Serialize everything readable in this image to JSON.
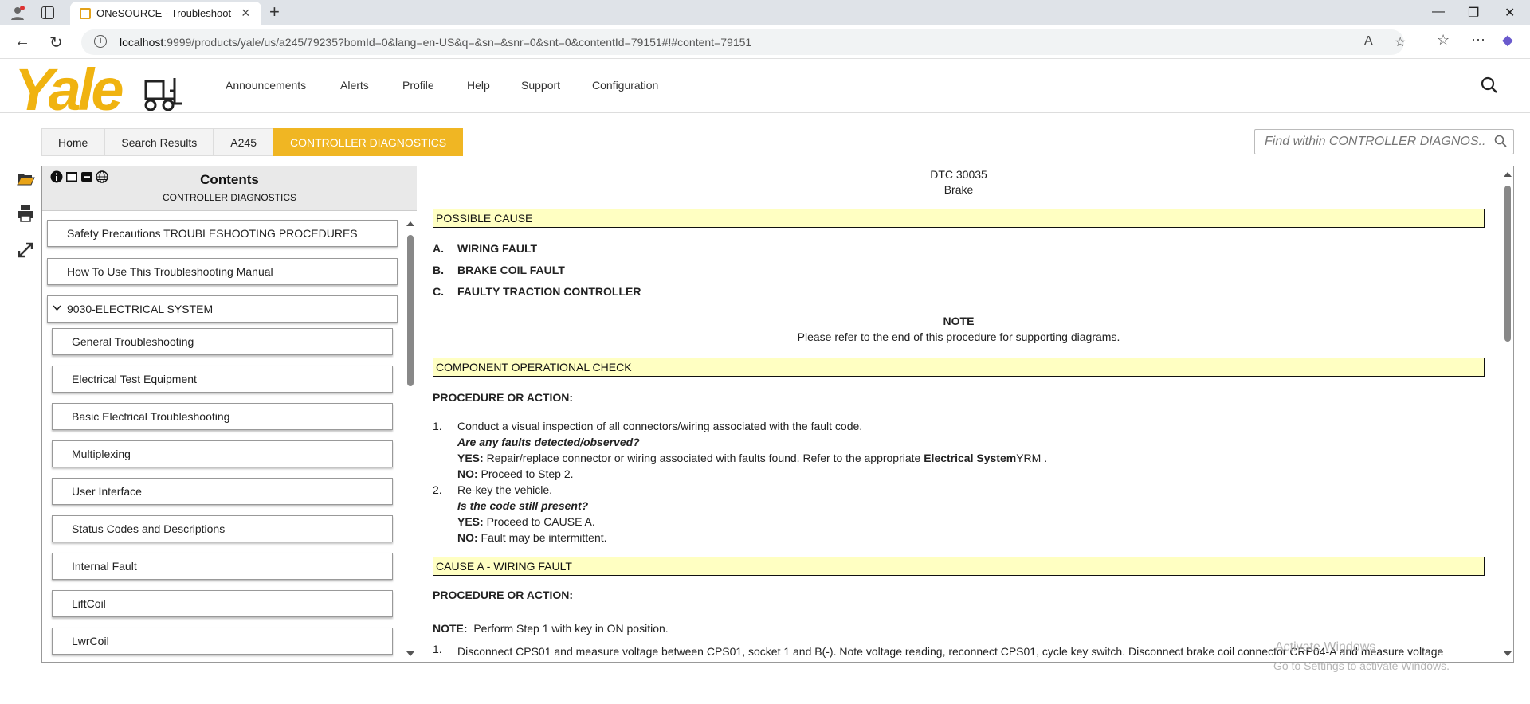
{
  "browser": {
    "tab_title": "ONeSOURCE - Troubleshooting -",
    "url_host": "localhost",
    "url_rest": ":9999/products/yale/us/a245/79235?bomId=0&lang=en-US&q=&sn=&snr=0&snt=0&contentId=79151#!#content=79151"
  },
  "header": {
    "logo": "Yale",
    "nav": [
      "Announcements",
      "Alerts",
      "Profile",
      "Help",
      "Support",
      "Configuration"
    ]
  },
  "breadcrumb": [
    "Home",
    "Search Results",
    "A245",
    "CONTROLLER DIAGNOSTICS"
  ],
  "find": {
    "placeholder": "Find within CONTROLLER DIAGNOS..."
  },
  "contents": {
    "title": "Contents",
    "subtitle": "CONTROLLER DIAGNOSTICS",
    "items": [
      "Safety Precautions TROUBLESHOOTING PROCEDURES",
      "How To Use This Troubleshooting Manual",
      "9030-ELECTRICAL SYSTEM",
      "General Troubleshooting",
      "Electrical Test Equipment",
      "Basic Electrical Troubleshooting",
      "Multiplexing",
      "User Interface",
      "Status Codes and Descriptions",
      "Internal Fault",
      "LiftCoil",
      "LwrCoil"
    ]
  },
  "doc": {
    "dtc": "DTC 30035",
    "name": "Brake",
    "possible_cause": "POSSIBLE CAUSE",
    "causes": [
      {
        "letter": "A.",
        "text": "WIRING FAULT"
      },
      {
        "letter": "B.",
        "text": "BRAKE COIL FAULT"
      },
      {
        "letter": "C.",
        "text": "FAULTY TRACTION CONTROLLER"
      }
    ],
    "note_title": "NOTE",
    "note_text": "Please refer to the end of this procedure for supporting diagrams.",
    "component_check": "COMPONENT OPERATIONAL CHECK",
    "proc_label": "PROCEDURE OR ACTION:",
    "step1_num": "1.",
    "step1_text": "Conduct a visual inspection of all connectors/wiring associated with the fault code.",
    "step1_q": "Are any faults detected/observed?",
    "yes": "YES:",
    "no": "NO:",
    "step1_yes": " Repair/replace connector or wiring associated with faults found. Refer to the appropriate ",
    "step1_yes_bold": "Electrical System",
    "step1_yes_end": "YRM .",
    "step1_no": " Proceed to ",
    "step1_no_link": "Step 2",
    "step1_no_end": ".",
    "step2_num": "2.",
    "step2_text": "Re-key the vehicle.",
    "step2_q": "Is the code still present?",
    "step2_yes": " Proceed to ",
    "step2_yes_link": "CAUSE A",
    "step2_yes_end": ".",
    "step2_no": " Fault may be intermittent.",
    "cause_a": "CAUSE A - WIRING FAULT",
    "proc_label2": "PROCEDURE OR ACTION:",
    "note2_label": "NOTE:",
    "note2_text": "Perform Step 1 with key in ON position.",
    "a_step1_num": "1.",
    "a_step1_text": "Disconnect CPS01 and measure voltage between CPS01, socket 1 and B(-). Note voltage reading, reconnect CPS01, cycle key switch. Disconnect brake coil connector CRP04-A and measure voltage"
  },
  "watermark": {
    "line1": "Activate Windows",
    "line2": "Go to Settings to activate Windows."
  }
}
